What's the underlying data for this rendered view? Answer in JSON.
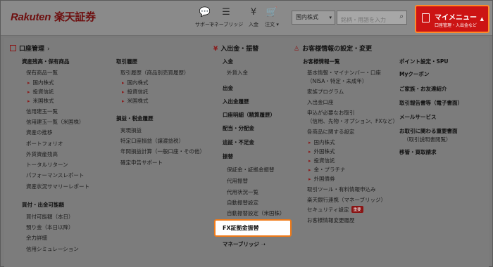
{
  "header": {
    "logo_en": "Rakuten",
    "logo_ja": "楽天証券",
    "icons": [
      {
        "name": "support-icon",
        "glyph": "💬",
        "label": "サポート"
      },
      {
        "name": "money-bridge-icon",
        "glyph": "☰",
        "label": "マネーブリッジ"
      },
      {
        "name": "deposit-icon",
        "glyph": "¥",
        "label": "入金"
      },
      {
        "name": "cart-icon",
        "glyph": "🛒",
        "label": "注文"
      }
    ],
    "market_select": "国内株式",
    "search_placeholder": "銘柄・用語を入力",
    "mymenu_title": "マイメニュー",
    "mymenu_sub": "口座管理・入出金など"
  },
  "account": {
    "title": "口座管理",
    "col1": [
      {
        "text": "資産残高・保有商品",
        "type": "group"
      },
      {
        "text": "保有商品一覧",
        "type": "item"
      },
      {
        "text": "国内株式",
        "type": "sub"
      },
      {
        "text": "投資信託",
        "type": "sub"
      },
      {
        "text": "米国株式",
        "type": "sub"
      },
      {
        "text": "信用建玉一覧",
        "type": "item"
      },
      {
        "text": "信用建玉一覧（米国株）",
        "type": "item"
      },
      {
        "text": "資産の推移",
        "type": "item"
      },
      {
        "text": "ポートフォリオ",
        "type": "item"
      },
      {
        "text": "外貨資産残高",
        "type": "item"
      },
      {
        "text": "トータルリターン",
        "type": "item"
      },
      {
        "text": "パフォーマンスレポート",
        "type": "item"
      },
      {
        "text": "資産状況サマリーレポート",
        "type": "item"
      },
      {
        "text": "買付・出金可能額",
        "type": "group"
      },
      {
        "text": "買付可能額（本日）",
        "type": "item"
      },
      {
        "text": "預り金（本日以降）",
        "type": "item"
      },
      {
        "text": "余力詳細",
        "type": "item"
      },
      {
        "text": "信用シミュレーション",
        "type": "item"
      }
    ],
    "col2": [
      {
        "text": "取引履歴",
        "type": "group"
      },
      {
        "text": "取引履歴（商品別売買履歴）",
        "type": "item"
      },
      {
        "text": "国内株式",
        "type": "sub"
      },
      {
        "text": "投資信託",
        "type": "sub"
      },
      {
        "text": "米国株式",
        "type": "sub"
      },
      {
        "text": "損益・税金履歴",
        "type": "group"
      },
      {
        "text": "実現損益",
        "type": "item"
      },
      {
        "text": "特定口座損益（譲渡益税）",
        "type": "item"
      },
      {
        "text": "年間損益計算（一般口座・その他）",
        "type": "item"
      },
      {
        "text": "確定申告サポート",
        "type": "item"
      }
    ]
  },
  "deposit": {
    "title": "入出金・振替",
    "items": [
      {
        "text": "入金",
        "type": "group"
      },
      {
        "text": "外貨入金",
        "type": "item"
      },
      {
        "text": "出金",
        "type": "group"
      },
      {
        "text": "入出金履歴",
        "type": "group"
      },
      {
        "text": "口座明細（精算履歴）",
        "type": "group"
      },
      {
        "text": "配当・分配金",
        "type": "group"
      },
      {
        "text": "追証・不足金",
        "type": "group"
      },
      {
        "text": "振替",
        "type": "group"
      },
      {
        "text": "保証金・証拠金振替",
        "type": "item"
      },
      {
        "text": "代用振替",
        "type": "item"
      },
      {
        "text": "代用状況一覧",
        "type": "item"
      },
      {
        "text": "自動振替設定",
        "type": "item"
      },
      {
        "text": "自動振替設定（米国株）",
        "type": "item"
      }
    ],
    "highlight": "FX証拠金振替",
    "money_bridge": "マネーブリッジ ➝"
  },
  "customer": {
    "title": "お客様情報の設定・変更",
    "col1": [
      {
        "text": "お客様情報一覧",
        "type": "group"
      },
      {
        "text": "基本情報・マイナンバー・口座",
        "type": "item"
      },
      {
        "text": "（NISA・特定・未成年）",
        "type": "item"
      },
      {
        "text": "家族プログラム",
        "type": "item"
      },
      {
        "text": "入出金口座",
        "type": "item"
      },
      {
        "text": "申込が必要なお取引",
        "type": "item"
      },
      {
        "text": "（信用、先物・オプション、FXなど）",
        "type": "item"
      },
      {
        "text": "各商品に関する設定",
        "type": "item"
      },
      {
        "text": "国内株式",
        "type": "sub"
      },
      {
        "text": "外国株式",
        "type": "sub"
      },
      {
        "text": "投資信託",
        "type": "sub"
      },
      {
        "text": "金・プラチナ",
        "type": "sub"
      },
      {
        "text": "外国債券",
        "type": "sub"
      },
      {
        "text": "取引ツール・有料情報申込み",
        "type": "item"
      },
      {
        "text": "楽天銀行連携（マネーブリッジ）",
        "type": "item"
      },
      {
        "text": "セキュリティ設定",
        "type": "item",
        "badge": "重要"
      },
      {
        "text": "お客様情報変更履歴",
        "type": "item"
      }
    ],
    "col2": [
      {
        "text": "ポイント設定・SPU",
        "type": "group"
      },
      {
        "text": "Myクーポン",
        "type": "group"
      },
      {
        "text": "ご家族・お友達紹介",
        "type": "group"
      },
      {
        "text": "取引報告書等（電子書面）",
        "type": "group"
      },
      {
        "text": "メールサービス",
        "type": "group"
      },
      {
        "text": "お取引に関わる重要書面",
        "type": "group"
      },
      {
        "text": "（取引説明書閲覧）",
        "type": "item"
      },
      {
        "text": "移管・買取請求",
        "type": "group"
      }
    ]
  }
}
